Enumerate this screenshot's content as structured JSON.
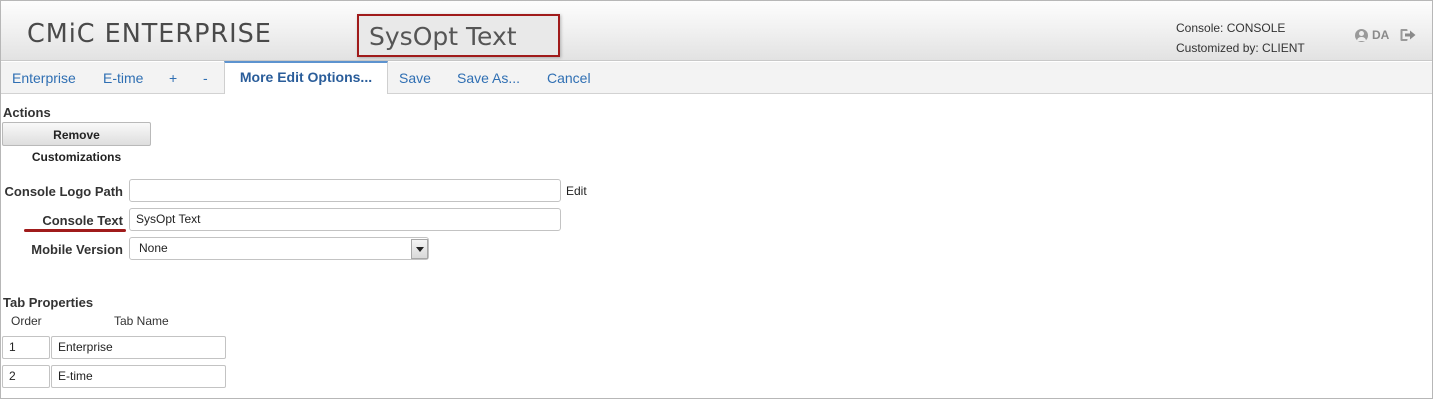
{
  "header": {
    "brand": "CMiC ENTERPRISE",
    "console_title": "SysOpt Text",
    "console_info": "Console: CONSOLE",
    "customized_info": "Customized by: CLIENT",
    "user_initials": "DA"
  },
  "toolbar": {
    "items": [
      {
        "label": "Enterprise"
      },
      {
        "label": "E-time"
      },
      {
        "label": "+"
      },
      {
        "label": "-"
      },
      {
        "label": "More Edit Options..."
      },
      {
        "label": "Save"
      },
      {
        "label": "Save As..."
      },
      {
        "label": "Cancel"
      }
    ]
  },
  "actions": {
    "heading": "Actions",
    "remove_button": "Remove Customizations"
  },
  "form": {
    "logo_path_label": "Console Logo Path",
    "logo_path_value": "",
    "edit_link": "Edit",
    "console_text_label": "Console Text",
    "console_text_value": "SysOpt Text",
    "mobile_version_label": "Mobile Version",
    "mobile_version_value": "None"
  },
  "tab_properties": {
    "heading": "Tab Properties",
    "columns": [
      "Order",
      "Tab Name"
    ],
    "rows": [
      {
        "order": "1",
        "name": "Enterprise"
      },
      {
        "order": "2",
        "name": "E-time"
      }
    ]
  },
  "colors": {
    "highlight_red": "#a01b1b",
    "link_blue": "#2f6fb3",
    "active_tab_border": "#5d93cf"
  }
}
